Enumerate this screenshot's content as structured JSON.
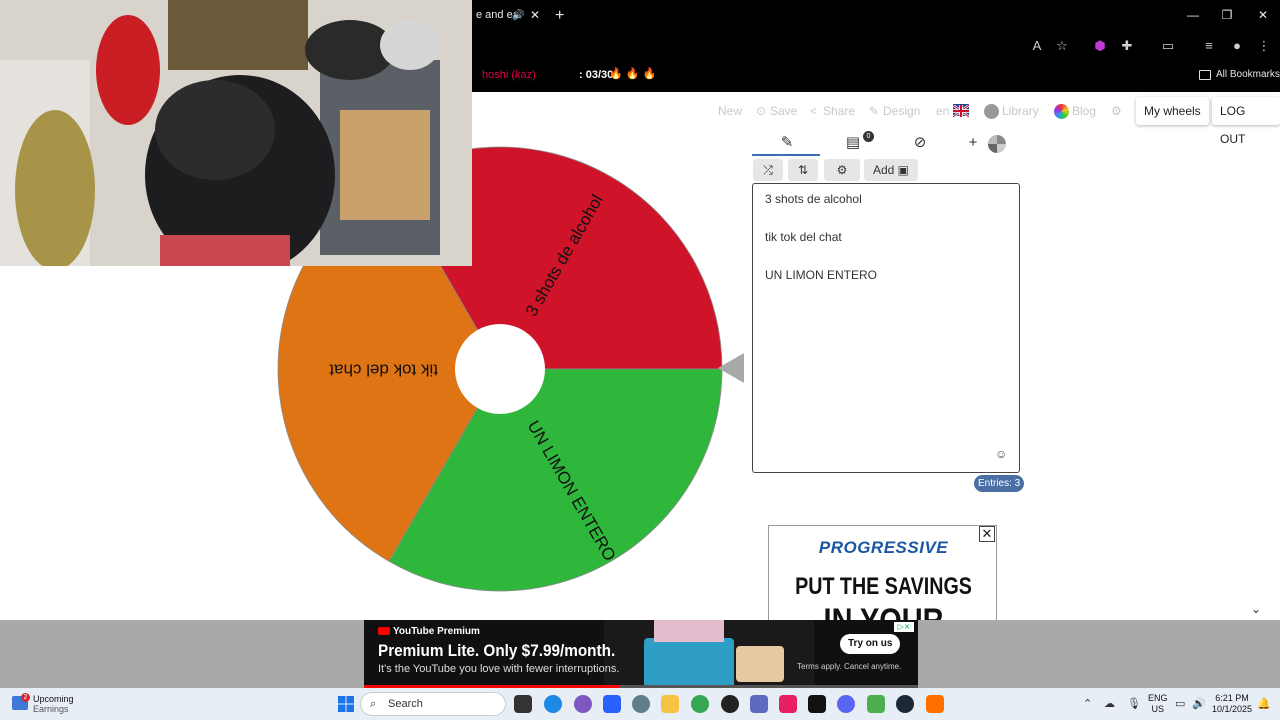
{
  "browser": {
    "tab_title": "e and ea",
    "tab_close": "✕",
    "new_tab": "+",
    "bookmark_prefix": "hoshi (kaz)",
    "bookmark_counter": ": 03/30",
    "bookmark_emojis": "🔥 🔥 🔥",
    "all_bookmarks": "All Bookmarks"
  },
  "app_nav": {
    "new": "New",
    "save": "Save",
    "share": "Share",
    "design": "Design",
    "lang": "en",
    "library": "Library",
    "blog": "Blog",
    "my_wheels": "My wheels",
    "logout": "LOG OUT"
  },
  "editor": {
    "add_label": "Add",
    "results_badge": "0",
    "entries": [
      "3 shots de alcohol",
      "tik tok del chat",
      "UN LIMON ENTERO"
    ],
    "entries_count": "Entries: 3"
  },
  "wheel": {
    "segments": [
      {
        "label": "3 shots de alcohol",
        "color": "#cf1429"
      },
      {
        "label": "UN LIMON ENTERO",
        "color": "#2fb73c"
      },
      {
        "label": "tik tok del chat",
        "color": "#df7415"
      }
    ]
  },
  "ad": {
    "brand": "PROGRESSIVE",
    "line1": "PUT THE SAVINGS",
    "line2": "IN YOUR"
  },
  "youtube_ad": {
    "logo": "YouTube Premium",
    "headline": "Premium Lite. Only $7.99/month.",
    "sub": "It's the YouTube you love with fewer interruptions.",
    "cta": "Try on us",
    "terms": "Terms apply. Cancel anytime.",
    "progress": 0.46
  },
  "taskbar": {
    "widget_title": "Upcoming",
    "widget_sub": "Earnings",
    "widget_badge": "2",
    "search": "Search",
    "lang_line1": "ENG",
    "lang_line2": "US",
    "time": "6:21 PM",
    "date": "10/1/2025"
  }
}
